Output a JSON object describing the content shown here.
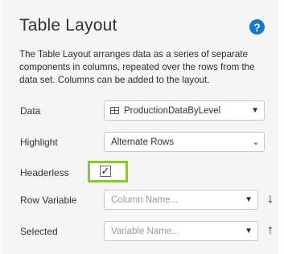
{
  "title": "Table Layout",
  "description": "The Table Layout arranges data as a series of separate components in columns, repeated over the rows from the data set. Columns can be added to the layout.",
  "fields": {
    "data": {
      "label": "Data",
      "value": "ProductionDataByLevel"
    },
    "highlight": {
      "label": "Highlight",
      "value": "Alternate Rows"
    },
    "headerless": {
      "label": "Headerless",
      "checked": true
    },
    "row_variable": {
      "label": "Row Variable",
      "placeholder": "Column Name..."
    },
    "selected": {
      "label": "Selected",
      "placeholder": "Variable Name..."
    }
  },
  "icons": {
    "help": "?",
    "check": "✓",
    "caret": "▼",
    "chevron": "⌄",
    "sort_down": "↓",
    "sort_up": "↑"
  },
  "colors": {
    "accent": "#8dc43f",
    "help": "#1878c8"
  }
}
